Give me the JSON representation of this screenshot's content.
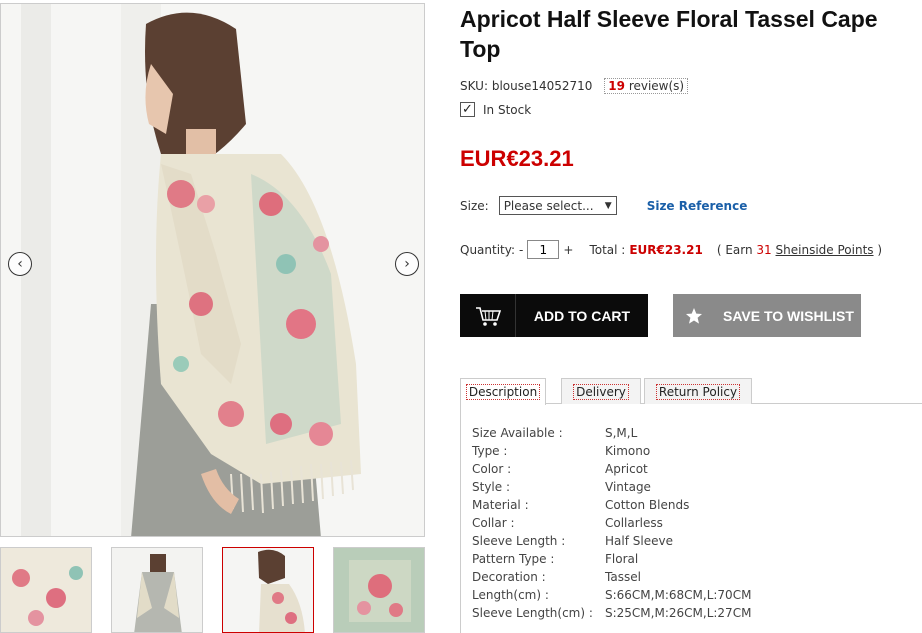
{
  "product": {
    "title": "Apricot Half Sleeve Floral Tassel Cape Top",
    "sku_label": "SKU:",
    "sku_value": "blouse14052710",
    "review_count": "19",
    "review_label": "review(s)",
    "stock": "In Stock",
    "price": "EUR€23.21"
  },
  "size": {
    "label": "Size:",
    "select_value": "Please select...",
    "reference_link": "Size Reference"
  },
  "quantity": {
    "label": "Quantity:",
    "minus": "-",
    "value": "1",
    "plus": "+",
    "total_label": "Total :",
    "total_price": "EUR€23.21",
    "earn_prefix": "( Earn",
    "earn_points": "31",
    "earn_link": "Sheinside Points",
    "earn_suffix": ")"
  },
  "buttons": {
    "add_to_cart": "ADD TO CART",
    "save_to_wishlist": "SAVE TO WISHLIST"
  },
  "gallery": {
    "prev_icon": "chevron-left-icon",
    "next_icon": "chevron-right-icon",
    "active_thumb_index": 2,
    "colors": {
      "accent": "#cc0000",
      "link": "#1a5fa8",
      "cart_bg": "#0b0b0b",
      "wishlist_bg": "#8a8a8a"
    }
  },
  "tabs": [
    {
      "label": "Description"
    },
    {
      "label": "Delivery"
    },
    {
      "label": "Return Policy"
    }
  ],
  "specs": [
    {
      "key": "Size Available :",
      "value": "S,M,L"
    },
    {
      "key": "Type :",
      "value": "Kimono"
    },
    {
      "key": "Color :",
      "value": "Apricot"
    },
    {
      "key": "Style :",
      "value": "Vintage"
    },
    {
      "key": "Material :",
      "value": "Cotton Blends"
    },
    {
      "key": "Collar :",
      "value": "Collarless"
    },
    {
      "key": "Sleeve Length :",
      "value": "Half Sleeve"
    },
    {
      "key": "Pattern Type :",
      "value": "Floral"
    },
    {
      "key": "Decoration :",
      "value": "Tassel"
    },
    {
      "key": "Length(cm) :",
      "value": "S:66CM,M:68CM,L:70CM"
    },
    {
      "key": "Sleeve Length(cm) :",
      "value": "S:25CM,M:26CM,L:27CM"
    }
  ]
}
